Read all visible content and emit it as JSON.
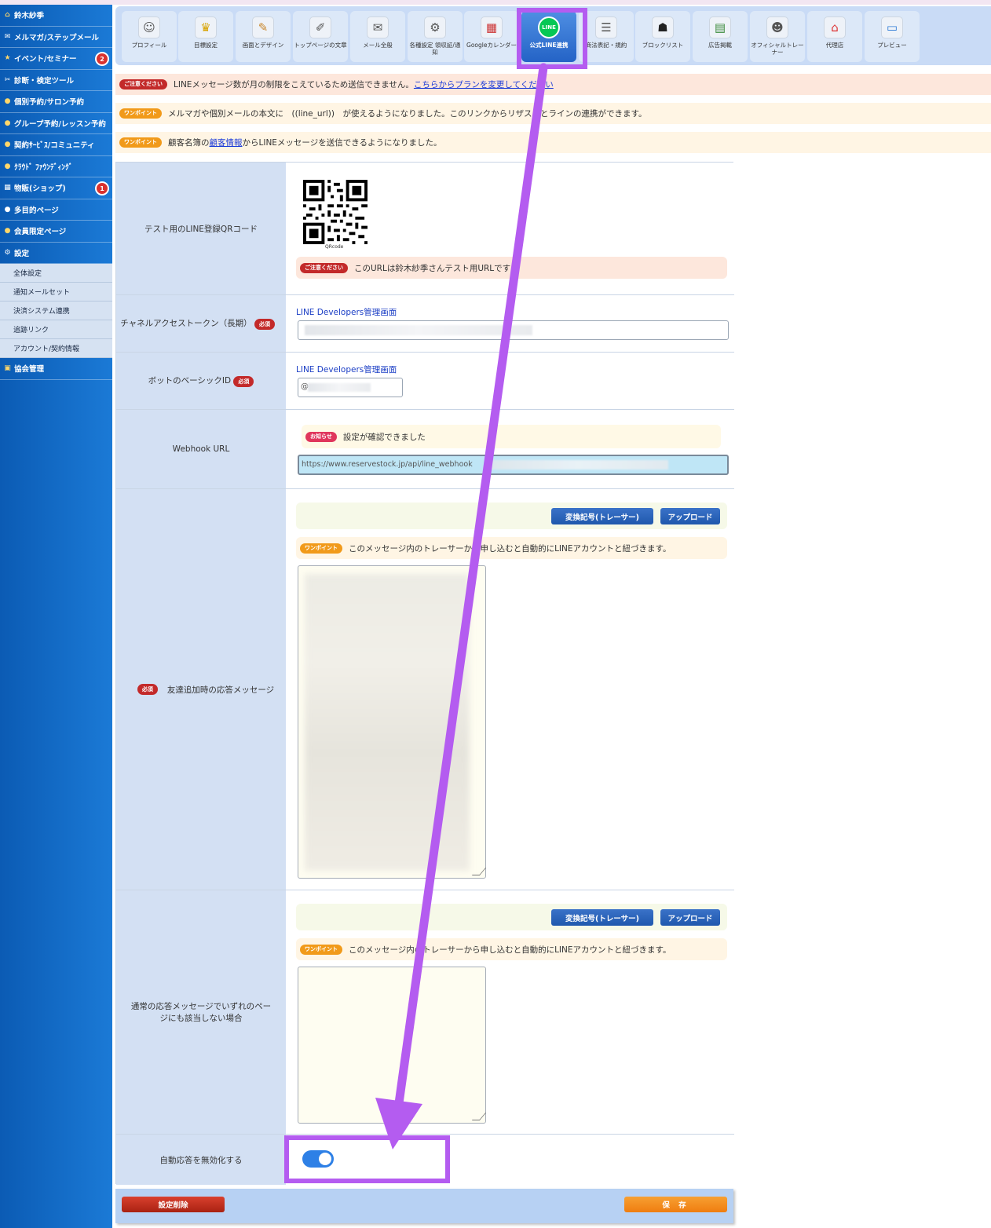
{
  "sidebar": {
    "items": [
      {
        "label": "鈴木紗季",
        "icon": "home-icon",
        "badge": ""
      },
      {
        "label": "メルマガ/ステップメール",
        "icon": "mail-icon",
        "badge": ""
      },
      {
        "label": "イベント/セミナー",
        "icon": "star-icon",
        "badge": "2"
      },
      {
        "label": "診断・検定ツール",
        "icon": "tools-icon",
        "badge": ""
      },
      {
        "label": "個別予約/サロン予約",
        "icon": "person-icon",
        "badge": ""
      },
      {
        "label": "グループ予約/レッスン予約",
        "icon": "group-icon",
        "badge": ""
      },
      {
        "label": "契約ｻｰﾋﾞｽ/コミュニティ",
        "icon": "community-icon",
        "badge": ""
      },
      {
        "label": "ｸﾗｳﾄﾞ ﾌｧｳﾝﾃﾞｨﾝｸﾞ",
        "icon": "crowdfunding-icon",
        "badge": ""
      },
      {
        "label": "物販(ショップ)",
        "icon": "shop-icon",
        "badge": "1"
      },
      {
        "label": "多目的ページ",
        "icon": "page-icon",
        "badge": ""
      },
      {
        "label": "会員限定ページ",
        "icon": "lock-icon",
        "badge": ""
      },
      {
        "label": "設定",
        "icon": "gear-icon",
        "badge": ""
      }
    ],
    "sub_items": [
      "全体設定",
      "通知メールセット",
      "決済システム連携",
      "追跡リンク",
      "アカウント/契約情報"
    ],
    "last_item": {
      "label": "協会管理",
      "icon": "building-icon"
    }
  },
  "tabs": [
    {
      "label": "プロフィール",
      "icon": "profile-icon"
    },
    {
      "label": "目標設定",
      "icon": "trophy-icon"
    },
    {
      "label": "画面とデザイン",
      "icon": "palette-icon"
    },
    {
      "label": "トップページの文章",
      "icon": "document-icon"
    },
    {
      "label": "メール全般",
      "icon": "mail-icon"
    },
    {
      "label": "各種設定 領収証/通知",
      "icon": "settings-icon"
    },
    {
      "label": "Googleカレンダー",
      "icon": "calendar-icon"
    },
    {
      "label": "公式LINE連携",
      "icon": "line-icon",
      "icon_text": "LINE",
      "active": true
    },
    {
      "label": "商法表記・規約",
      "icon": "legal-icon"
    },
    {
      "label": "ブロックリスト",
      "icon": "blocklist-icon"
    },
    {
      "label": "広告掲載",
      "icon": "ad-icon"
    },
    {
      "label": "オフィシャルトレーナー",
      "icon": "trainer-icon"
    },
    {
      "label": "代理店",
      "icon": "agency-icon"
    },
    {
      "label": "プレビュー",
      "icon": "monitor-icon"
    }
  ],
  "notices": {
    "limit": {
      "pill": "ご注意ください",
      "text": "LINEメッセージ数が月の制限をこえているため送信できません。",
      "link": "こちらからプランを変更してください"
    },
    "line_url": {
      "pill": "ワンポイント",
      "text": "メルマガや個別メールの本文に　((line_url))　が使えるようになりました。このリンクからリザストとラインの連携ができます。"
    },
    "customer": {
      "pill": "ワンポイント",
      "text_before": "顧客名簿の",
      "link": "顧客情報",
      "text_after": " からLINEメッセージを送信できるようになりました。"
    }
  },
  "form": {
    "qr": {
      "label": "テスト用のLINE登録QRコード",
      "qr_caption": "QRcode",
      "pill": "ご注意ください",
      "note": "このURLは鈴木紗季さんテスト用URLです"
    },
    "token": {
      "label": "チャネルアクセストークン（長期）",
      "required": "必須",
      "link": "LINE Developers管理画面"
    },
    "bot_id": {
      "label": "ボットのベーシックID",
      "required": "必須",
      "link": "LINE Developers管理画面",
      "value_prefix": "@"
    },
    "webhook": {
      "label": "Webhook URL",
      "pill": "お知らせ",
      "status": "設定が確認できました",
      "url_prefix": "https://www.reservestock.jp/api/line_webhook"
    },
    "friend_msg": {
      "label": "友達追加時の応答メッセージ",
      "required": "必須",
      "btn_tracer": "変換記号(トレーサー)",
      "btn_upload": "アップロード",
      "pill": "ワンポイント",
      "hint": "このメッセージ内のトレーサーから申し込むと自動的にLINEアカウントと紐づきます。"
    },
    "default_msg": {
      "label": "通常の応答メッセージでいずれのページにも該当しない場合",
      "btn_tracer": "変換記号(トレーサー)",
      "btn_upload": "アップロード",
      "pill": "ワンポイント",
      "hint": "このメッセージ内のトレーサーから申し込むと自動的にLINEアカウントと紐づきます。"
    },
    "auto_reply": {
      "label": "自動応答を無効化する",
      "enabled": true
    }
  },
  "footer": {
    "delete_label": "設定削除",
    "save_label": "保 存"
  },
  "colors": {
    "annotation": "#b45cf0",
    "sidebar": "#1b7ad6",
    "line_green": "#06c755"
  }
}
